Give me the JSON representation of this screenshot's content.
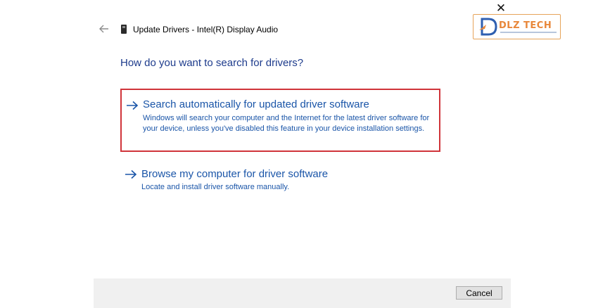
{
  "window": {
    "title": "Update Drivers - Intel(R) Display Audio",
    "close_glyph": "✕",
    "back_icon": "back-arrow-icon",
    "device_icon": "audio-device-icon"
  },
  "watermark": {
    "text": "DLZ TECH",
    "accent_color": "#e8873a",
    "icon": "dlz-tech-logo"
  },
  "main": {
    "heading": "How do you want to search for drivers?",
    "options": [
      {
        "title": "Search automatically for updated driver software",
        "description": "Windows will search your computer and the Internet for the latest driver software for your device, unless you've disabled this feature in your device installation settings.",
        "highlighted": true,
        "highlight_color": "#d0343a",
        "icon": "arrow-right-icon"
      },
      {
        "title": "Browse my computer for driver software",
        "description": "Locate and install driver software manually.",
        "highlighted": false,
        "icon": "arrow-right-icon"
      }
    ]
  },
  "footer": {
    "cancel_label": "Cancel"
  },
  "colors": {
    "link_blue": "#1a55a8",
    "heading_blue": "#1d3b8c",
    "footer_bg": "#f0f0f0"
  }
}
